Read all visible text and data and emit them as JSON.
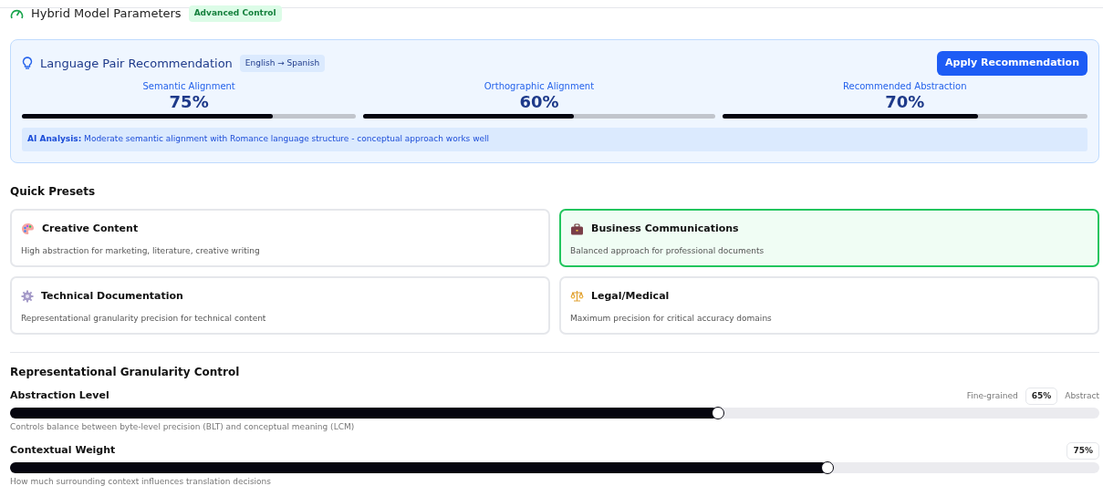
{
  "header": {
    "title": "Hybrid Model Parameters",
    "badge": "Advanced Control"
  },
  "recommendation": {
    "title": "Language Pair Recommendation",
    "pair": "English → Spanish",
    "button": "Apply Recommendation",
    "metrics": [
      {
        "label": "Semantic Alignment",
        "value": "75%",
        "level": 0.75
      },
      {
        "label": "Orthographic Alignment",
        "value": "60%",
        "level": 0.6
      },
      {
        "label": "Recommended Abstraction",
        "value": "70%",
        "level": 0.7
      }
    ],
    "analysis": "**AI Analysis:** Moderate semantic alignment with Romance language structure - conceptual approach works well"
  },
  "presets": {
    "title": "Quick Presets",
    "items": [
      {
        "kind": "palette",
        "title": "Creative Content",
        "description": "High abstraction for marketing, literature, creative writing",
        "selected": false
      },
      {
        "kind": "briefcase",
        "title": "Business Communications",
        "description": "Balanced approach for professional documents",
        "selected": true
      },
      {
        "kind": "gear",
        "title": "Technical Documentation",
        "description": "Representational granularity precision for technical content",
        "selected": false
      },
      {
        "kind": "scales",
        "title": "Legal/Medical",
        "description": "Maximum precision for critical accuracy domains",
        "selected": false
      }
    ]
  },
  "granularity": {
    "title": "Representational Granularity Control",
    "sliders": [
      {
        "label": "Abstraction Level",
        "min_label": "Fine-grained",
        "value": "65%",
        "max_label": "Abstract",
        "level": 0.65,
        "help": "Controls balance between byte-level precision (BLT) and conceptual meaning (LCM)"
      },
      {
        "label": "Contextual Weight",
        "value": "75%",
        "level": 0.75,
        "help": "How much surrounding context influences translation decisions"
      }
    ]
  }
}
